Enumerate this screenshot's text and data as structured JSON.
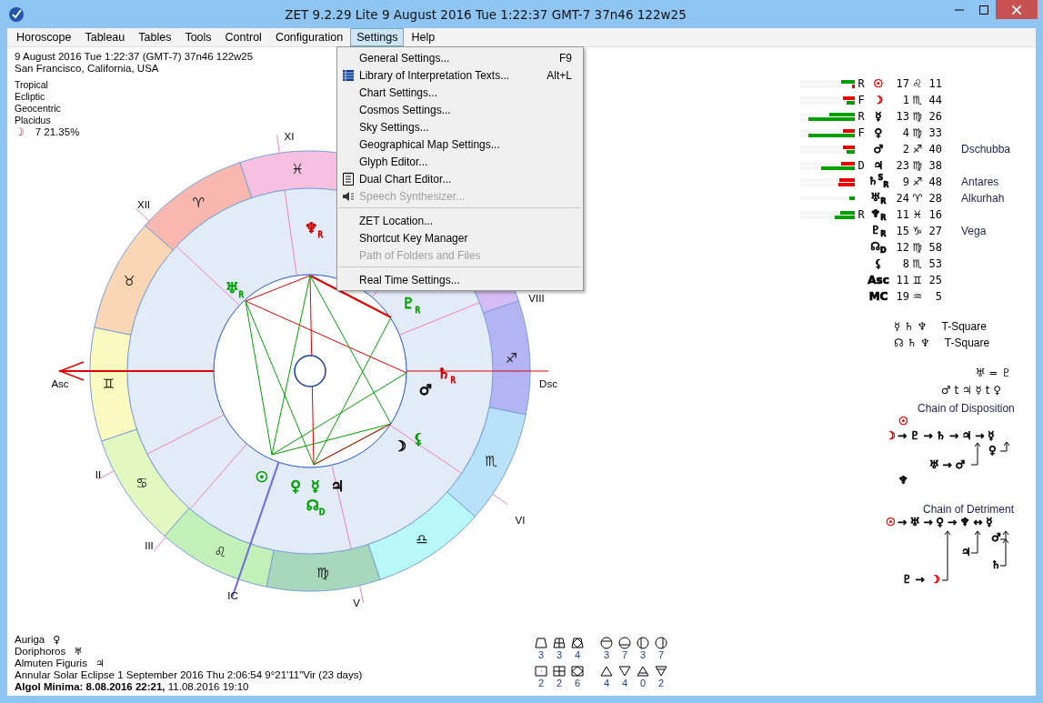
{
  "window": {
    "title": "ZET 9.2.29 Lite    9 August 2016   Tue    1:22:37 GMT-7 37n46   122w25"
  },
  "menu_bar": [
    {
      "label": "Horoscope",
      "selected": false
    },
    {
      "label": "Tableau",
      "selected": false
    },
    {
      "label": "Tables",
      "selected": false
    },
    {
      "label": "Tools",
      "selected": false
    },
    {
      "label": "Control",
      "selected": false
    },
    {
      "label": "Configuration",
      "selected": false
    },
    {
      "label": "Settings",
      "selected": true
    },
    {
      "label": "Help",
      "selected": false
    }
  ],
  "settings_menu": [
    {
      "kind": "item",
      "label": "General Settings...",
      "shortcut": "F9",
      "disabled": false
    },
    {
      "kind": "item",
      "label": "Library of Interpretation Texts...",
      "shortcut": "Alt+L",
      "disabled": false
    },
    {
      "kind": "item",
      "label": "Chart Settings...",
      "disabled": false
    },
    {
      "kind": "item",
      "label": "Cosmos Settings...",
      "disabled": false
    },
    {
      "kind": "item",
      "label": "Sky Settings...",
      "disabled": false
    },
    {
      "kind": "item",
      "label": "Geographical Map Settings...",
      "disabled": false
    },
    {
      "kind": "item",
      "label": "Glyph Editor...",
      "disabled": false
    },
    {
      "kind": "item",
      "label": "Dual Chart Editor...",
      "disabled": false
    },
    {
      "kind": "item",
      "label": "Speech Synthesizer...",
      "disabled": true
    },
    {
      "kind": "separator"
    },
    {
      "kind": "item",
      "label": "ZET Location...",
      "disabled": false
    },
    {
      "kind": "item",
      "label": "Shortcut Key Manager",
      "disabled": false
    },
    {
      "kind": "item",
      "label": "Path of Folders and Files",
      "disabled": true
    },
    {
      "kind": "separator"
    },
    {
      "kind": "item",
      "label": "Real Time Settings...",
      "disabled": false
    }
  ],
  "info": {
    "datetime": "9 August 2016   Tue    1:22:37 (GMT-7) 37n46   122w25",
    "place": "San Francisco, California, USA",
    "settings": [
      "Tropical",
      "Ecliptic",
      "Geocentric",
      "Placidus"
    ],
    "moon_glyph": "☽",
    "moon_phase": "7 21.35%"
  },
  "wheel": {
    "signs": [
      {
        "glyph": "♈",
        "color": "#f8b8b0"
      },
      {
        "glyph": "♉",
        "color": "#fad6b4"
      },
      {
        "glyph": "♊",
        "color": "#fafac0"
      },
      {
        "glyph": "♋",
        "color": "#e2f8c0"
      },
      {
        "glyph": "♌",
        "color": "#c2f0b8"
      },
      {
        "glyph": "♍",
        "color": "#a8d8bc"
      },
      {
        "glyph": "♎",
        "color": "#b8f8f8"
      },
      {
        "glyph": "♏",
        "color": "#b8e2fa"
      },
      {
        "glyph": "♐",
        "color": "#b4b4f4"
      },
      {
        "color": "#d4bcf6"
      },
      {
        "glyph": "♓",
        "color": "#f8c0e0"
      }
    ],
    "houses": [
      "XI",
      "XII",
      "Asc",
      "II",
      "III",
      "IC",
      "V",
      "VI",
      "Dsc",
      "VIII"
    ],
    "planets": [
      {
        "glyph": "♆$_{R}$",
        "color": "#cc0000"
      },
      {
        "glyph": "♅$_{R}$",
        "color": "#00a000"
      },
      {
        "glyph": "♇$_{R}$",
        "color": "#00a000"
      },
      {
        "glyph": "♄$_{R}$",
        "color": "#cc0000"
      },
      {
        "glyph": "♂",
        "color": "#000000"
      },
      {
        "glyph": "⚸",
        "color": "#00a000"
      },
      {
        "glyph": "☽",
        "color": "#000000"
      },
      {
        "glyph": "☉",
        "color": "#00a000"
      },
      {
        "glyph": "♀",
        "color": "#00a000"
      },
      {
        "glyph": "☿",
        "color": "#00a000"
      },
      {
        "glyph": "♃",
        "color": "#000000"
      },
      {
        "glyph": "☊$_{D}$",
        "color": "#00a000"
      }
    ]
  },
  "positions": [
    {
      "bars": [
        {
          "color": "#00a000",
          "level": 0.25
        },
        {
          "color": "#ee0000",
          "level": 0.05
        }
      ],
      "status": "R",
      "glyph": "☉",
      "color": "#ee0000",
      "degree": "17",
      "sign": "♌",
      "minute": "11"
    },
    {
      "bars": [
        {
          "color": "#ee0000",
          "level": 0.22
        },
        {
          "color": "#00a000",
          "level": 0.15
        }
      ],
      "status": "F",
      "glyph": "☽",
      "color": "#ee0000",
      "degree": "1",
      "sign": "♏",
      "minute": "44"
    },
    {
      "bars": [
        {
          "color": "#00a000",
          "level": 0.47
        },
        {
          "color": "#00a000",
          "level": 0.85
        }
      ],
      "status": "R",
      "glyph": "☿",
      "color": "#000000",
      "degree": "13",
      "sign": "♍",
      "minute": "26"
    },
    {
      "bars": [
        {
          "color": "#ee0000",
          "level": 0.22
        },
        {
          "color": "#00a000",
          "level": 0.85
        }
      ],
      "status": "F",
      "glyph": "♀",
      "color": "#000000",
      "degree": "4",
      "sign": "♍",
      "minute": "33"
    },
    {
      "bars": [
        {
          "color": "#ee0000",
          "level": 0.22
        },
        {
          "color": "#00a000",
          "level": 0.15
        }
      ],
      "glyph": "♂",
      "color": "#000000",
      "degree": "2",
      "sign": "♐",
      "minute": "40",
      "star": "Dschubba"
    },
    {
      "bars": [
        {
          "color": "#ee0000",
          "level": 0.25
        },
        {
          "color": "#00a000",
          "level": 0.62
        }
      ],
      "status": "D",
      "glyph": "♃",
      "color": "#000000",
      "degree": "23",
      "sign": "♍",
      "minute": "38"
    },
    {
      "bars": [
        {
          "color": "#ee0000",
          "level": 0.28
        },
        {
          "color": "#ee0000",
          "level": 0.3
        }
      ],
      "glyph": "♄$^{S}$$_{R}$",
      "color": "#000000",
      "degree": "9",
      "sign": "♐",
      "minute": "48",
      "star": "Antares"
    },
    {
      "bars": [
        {
          "color": "#00a000",
          "level": 0.1
        }
      ],
      "glyph": "♅$_{R}$",
      "color": "#000000",
      "degree": "24",
      "sign": "♈",
      "minute": "28",
      "star": "Alkurhah"
    },
    {
      "bars": [
        {
          "color": "#00a000",
          "level": 0.27
        },
        {
          "color": "#00a000",
          "level": 0.37
        }
      ],
      "status": "R",
      "glyph": "♆$_{R}$",
      "color": "#000000",
      "degree": "11",
      "sign": "♓",
      "minute": "16"
    },
    {
      "glyph": "♇$_{R}$",
      "color": "#000000",
      "degree": "15",
      "sign": "♑",
      "minute": "27",
      "star": "Vega"
    },
    {
      "glyph": "☊$_{D}$",
      "color": "#000000",
      "degree": "12",
      "sign": "♍",
      "minute": "58"
    },
    {
      "glyph": "⚸",
      "color": "#000000",
      "degree": "8",
      "sign": "♏",
      "minute": "53"
    },
    {
      "glyph": "Asc",
      "color": "#000000",
      "degree": "11",
      "sign": "♊",
      "minute": "25"
    },
    {
      "glyph": "MC",
      "color": "#000000",
      "degree": "19",
      "sign": "♒",
      "minute": "5"
    }
  ],
  "configurations": [
    {
      "planets": "☿  ♄  ♆",
      "name": "T-Square"
    },
    {
      "planets": "☊  ♄  ♆",
      "name": "T-Square"
    }
  ],
  "relations": [
    "♅ = ♇",
    "♂ t ♃   ☿ t ♀"
  ],
  "chains": [
    {
      "title": "Chain of Disposition",
      "nodes": [
        {
          "text": "☉",
          "color": "#ee0000"
        },
        {
          "text": "☽",
          "color": "#ee0000"
        },
        {
          "text": "→ ♇ → ♄ → ♃ → ☿",
          "color": "#000000"
        },
        {
          "text": "♀",
          "color": "#000000"
        },
        {
          "text": "♅ → ♂",
          "color": "#000000"
        },
        {
          "text": "♆",
          "color": "#000000"
        }
      ]
    },
    {
      "title": "Chain of Detriment",
      "nodes": [
        {
          "text": "☉",
          "color": "#ee0000"
        },
        {
          "text": "→ ♅ → ♀ → ♆ ↔ ☿",
          "color": "#000000"
        },
        {
          "text": "♂",
          "color": "#000000"
        },
        {
          "text": "♃",
          "color": "#000000"
        },
        {
          "text": "♄",
          "color": "#000000"
        },
        {
          "text": "♇ →",
          "color": "#000000"
        },
        {
          "text": "☽",
          "color": "#ee0000"
        }
      ]
    }
  ],
  "notes": [
    {
      "label": "Auriga",
      "glyph": "♀"
    },
    {
      "label": "Doriphoros",
      "glyph": "♅"
    },
    {
      "label": "Almuten Figuris",
      "glyph": "♃"
    }
  ],
  "eclipse": "Annular Solar Eclipse 1 September 2016 Thu  2:06:54  9°21'11\"Vir (23 days)",
  "algol": "**Algol Minima: 8.08.2016 22:21,**  11.08.2016 19:10",
  "pattern_counts": [
    [
      {
        "kind": "trapezoid",
        "count": "3"
      },
      {
        "kind": "grid-trapezoid",
        "count": "3"
      },
      {
        "kind": "diamond-trapezoid",
        "count": "4"
      },
      {
        "kind": "circle-top",
        "count": "3"
      },
      {
        "kind": "circle-bottom",
        "count": "7"
      },
      {
        "kind": "circle-left",
        "count": "3"
      },
      {
        "kind": "circle-right",
        "count": "7"
      }
    ],
    [
      {
        "kind": "square-dot",
        "count": "2"
      },
      {
        "kind": "square-grid",
        "count": "2"
      },
      {
        "kind": "square-diamond",
        "count": "6"
      },
      {
        "kind": "triangle-up",
        "count": "4"
      },
      {
        "kind": "triangle-down",
        "count": "4"
      },
      {
        "kind": "triangle-up-bar",
        "count": "0"
      },
      {
        "kind": "triangle-down-bar",
        "count": "2"
      }
    ]
  ]
}
